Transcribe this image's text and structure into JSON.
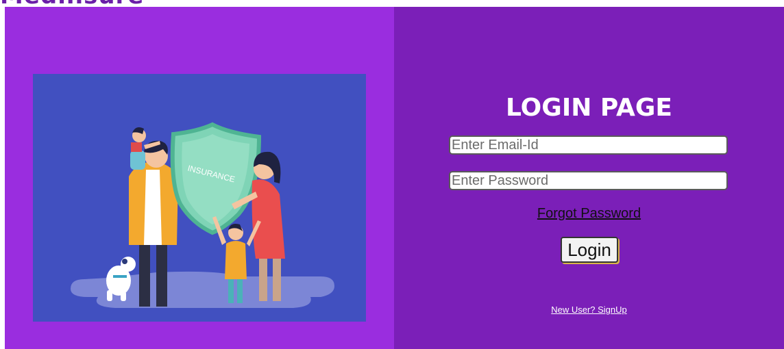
{
  "brand": {
    "name": "Medinsure"
  },
  "illustration": {
    "shield_text": "INSURANCE"
  },
  "login": {
    "title": "LOGIN PAGE",
    "email_placeholder": "Enter Email-Id",
    "password_placeholder": "Enter Password",
    "forgot_label": "Forgot Password",
    "login_label": "Login",
    "signup_label": "New User? SignUp"
  },
  "colors": {
    "left_panel": "#9a2ddf",
    "right_panel": "#7b1fb8",
    "illustration_bg": "#4150c0"
  }
}
